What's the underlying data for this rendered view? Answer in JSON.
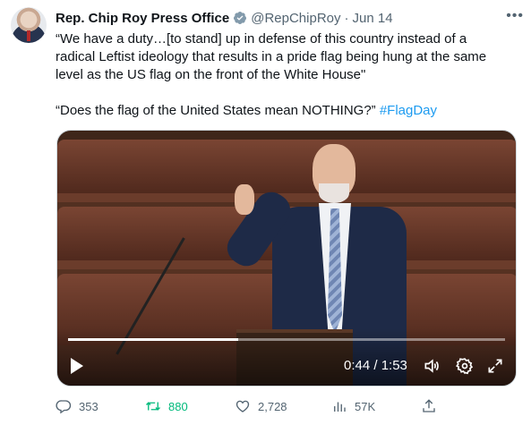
{
  "author": {
    "name": "Rep. Chip Roy Press Office",
    "handle": "@RepChipRoy",
    "separator": "·",
    "date": "Jun 14"
  },
  "menu_icon": "more-horizontal-icon",
  "tweet": {
    "line1": "“We have a duty…[to stand] up in defense of this country instead of a",
    "line2": "radical Leftist ideology that results in a pride flag being hung at the same",
    "line3": "level as the US flag on the front of the White House\"",
    "line4_text": "“Does the flag of the United States mean NOTHING?” ",
    "hashtag": "#FlagDay"
  },
  "video": {
    "current_time": "0:44",
    "duration": "1:53",
    "time_display": "0:44 / 1:53",
    "progress": 0.389
  },
  "actions": {
    "replies": "353",
    "retweets": "880",
    "likes": "2,728",
    "views": "57K"
  },
  "colors": {
    "accent": "#1d9bf0",
    "retweet": "#00ba7c",
    "muted": "#536471"
  }
}
